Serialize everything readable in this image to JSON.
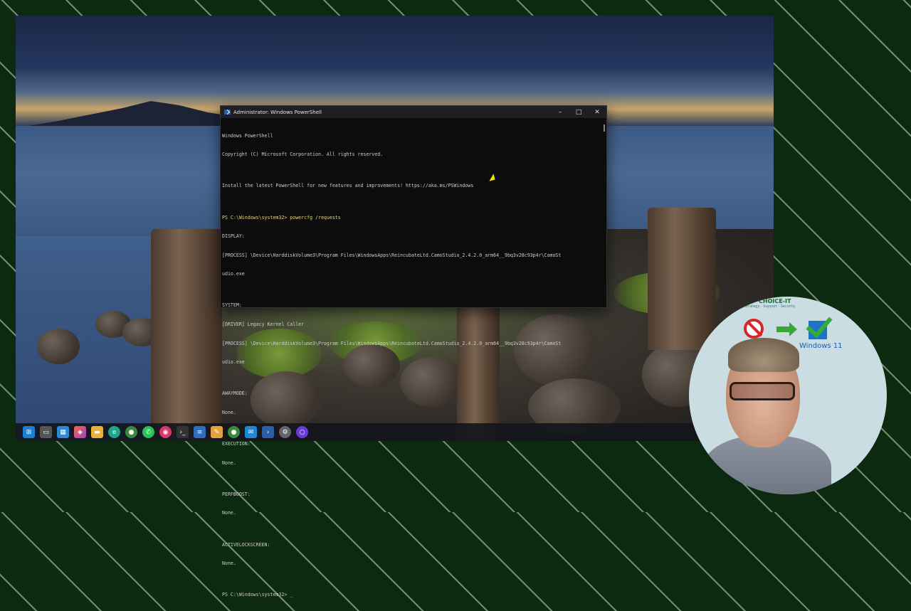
{
  "ps_window": {
    "title": "Administrator: Windows PowerShell",
    "controls": {
      "minimize": "–",
      "maximize": "□",
      "close": "✕"
    },
    "lines": [
      "Windows PowerShell",
      "Copyright (C) Microsoft Corporation. All rights reserved.",
      "",
      "Install the latest PowerShell for new features and improvements! https://aka.ms/PSWindows",
      "",
      "PS C:\\Windows\\system32> powercfg /requests",
      "DISPLAY:",
      "[PROCESS] \\Device\\HarddiskVolume3\\Program Files\\WindowsApps\\ReincubateLtd.CamoStudio_2.4.2.0_arm64__9bq3v28c93p4r\\CamoSt",
      "udio.exe",
      "",
      "SYSTEM:",
      "[DRIVER] Legacy Kernel Caller",
      "[PROCESS] \\Device\\HarddiskVolume3\\Program Files\\WindowsApps\\ReincubateLtd.CamoStudio_2.4.2.0_arm64__9bq3v28c93p4r\\CamoSt",
      "udio.exe",
      "",
      "AWAYMODE:",
      "None.",
      "",
      "EXECUTION:",
      "None.",
      "",
      "PERFBOOST:",
      "None.",
      "",
      "ACTIVELOCKSCREEN:",
      "None.",
      "",
      "PS C:\\Windows\\system32> _"
    ]
  },
  "taskbar": {
    "icons": [
      "start-icon",
      "task-view-icon",
      "store-icon",
      "copilot-icon",
      "file-explorer-icon",
      "edge-icon",
      "chrome-icon",
      "whatsapp-icon",
      "app-icon",
      "terminal-icon",
      "notepad-icon",
      "paint-icon",
      "chrome-alt-icon",
      "mail-icon",
      "powershell-icon",
      "settings-icon",
      "cortana-icon"
    ]
  },
  "overlay": {
    "brand": "CHOICE-IT",
    "brand_sub": "Strategy · Support · Security",
    "win11_label": "Windows 11"
  },
  "colors": {
    "accent": "#1f71c4",
    "prompt_cmd": "#e8d775"
  }
}
